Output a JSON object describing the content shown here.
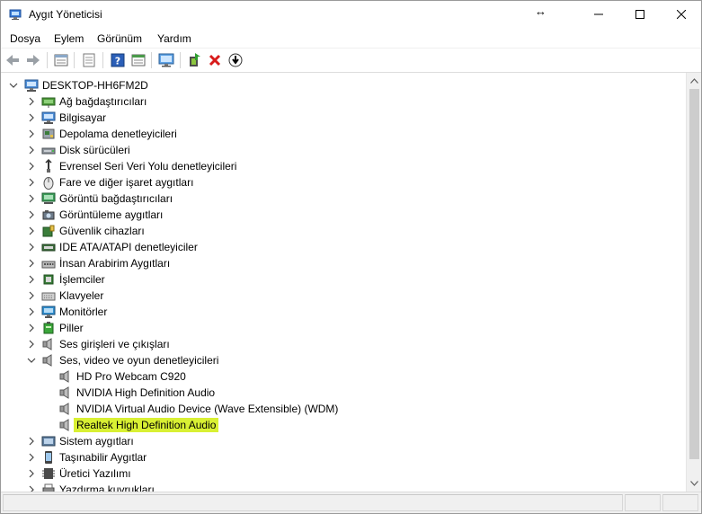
{
  "window": {
    "title": "Aygıt Yöneticisi",
    "drag_hint": "↔"
  },
  "menu": [
    "Dosya",
    "Eylem",
    "Görünüm",
    "Yardım"
  ],
  "toolbar": {
    "icons": [
      "back-icon",
      "forward-icon",
      "properties-icon",
      "show-hidden-icon",
      "help-icon",
      "details-icon",
      "monitor-icon",
      "update-driver-icon",
      "uninstall-icon",
      "download-icon"
    ]
  },
  "tree": {
    "root": "DESKTOP-HH6FM2D",
    "categories": [
      "Ağ bağdaştırıcıları",
      "Bilgisayar",
      "Depolama denetleyicileri",
      "Disk sürücüleri",
      "Evrensel Seri Veri Yolu denetleyicileri",
      "Fare ve diğer işaret aygıtları",
      "Görüntü bağdaştırıcıları",
      "Görüntüleme aygıtları",
      "Güvenlik cihazları",
      "IDE ATA/ATAPI denetleyiciler",
      "İnsan Arabirim Aygıtları",
      "İşlemciler",
      "Klavyeler",
      "Monitörler",
      "Piller",
      "Ses girişleri ve çıkışları",
      "Ses, video ve oyun denetleyicileri"
    ],
    "audio_devices": [
      "HD Pro Webcam C920",
      "NVIDIA High Definition Audio",
      "NVIDIA Virtual Audio Device (Wave Extensible) (WDM)",
      "Realtek High Definition Audio"
    ],
    "after": [
      "Sistem aygıtları",
      "Taşınabilir Aygıtlar",
      "Üretici Yazılımı",
      "Yazdırma kuyrukları"
    ],
    "highlight_color": "#d9f033"
  }
}
